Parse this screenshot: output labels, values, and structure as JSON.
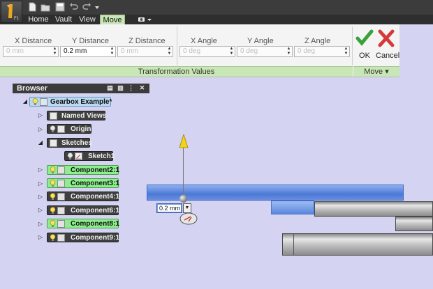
{
  "quick_access": {
    "icons": [
      "new-icon",
      "open-icon",
      "save-icon",
      "undo-icon",
      "redo-icon",
      "dropdown-icon"
    ]
  },
  "tabs": [
    {
      "label": "Home"
    },
    {
      "label": "Vault"
    },
    {
      "label": "View"
    },
    {
      "label": "Move"
    }
  ],
  "ribbon": {
    "labels": {
      "x_distance": "X Distance",
      "y_distance": "Y Distance",
      "z_distance": "Z Distance",
      "x_angle": "X Angle",
      "y_angle": "Y Angle",
      "z_angle": "Z Angle"
    },
    "values": {
      "x_distance": "0 mm",
      "y_distance": "0.2 mm",
      "z_distance": "0 mm",
      "x_angle": "0 deg",
      "y_angle": "0 deg",
      "z_angle": "0 deg"
    },
    "ok_label": "OK",
    "cancel_label": "Cancel",
    "panel_transformation": "Transformation Values",
    "panel_move": "Move"
  },
  "browser": {
    "title": "Browser",
    "root": "Gearbox Example*",
    "items": [
      {
        "label": "Named Views"
      },
      {
        "label": "Origin"
      },
      {
        "label": "Sketches"
      },
      {
        "label": "Sketch1"
      },
      {
        "label": "Component2:1"
      },
      {
        "label": "Component3:1"
      },
      {
        "label": "Component4:1"
      },
      {
        "label": "Component6:1"
      },
      {
        "label": "Component8:1"
      },
      {
        "label": "Component9:1"
      }
    ]
  },
  "viewport": {
    "distance_input": "0.2 mm"
  },
  "colors": {
    "accent": "#c9e7b6",
    "selection": "#4c79d5",
    "component_visible": "#8cee8c",
    "ok": "#3aa13a",
    "cancel": "#d43a3a"
  }
}
